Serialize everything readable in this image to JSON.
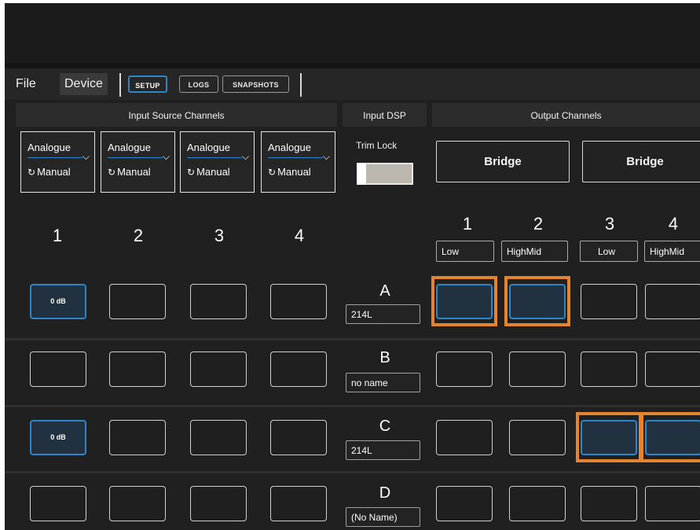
{
  "menu": {
    "file": "File",
    "device": "Device",
    "tabs": [
      {
        "label": "SETUP",
        "active": true
      },
      {
        "label": "LOGS",
        "active": false
      },
      {
        "label": "SNAPSHOTS",
        "active": false
      }
    ]
  },
  "sections": {
    "input_source": "Input Source Channels",
    "input_dsp": "Input DSP",
    "output_channels": "Output Channels"
  },
  "input_sources": [
    {
      "type": "Analogue",
      "mode": "Manual",
      "mode_icon": "refresh-icon"
    },
    {
      "type": "Analogue",
      "mode": "Manual",
      "mode_icon": "refresh-icon"
    },
    {
      "type": "Analogue",
      "mode": "Manual",
      "mode_icon": "refresh-icon"
    },
    {
      "type": "Analogue",
      "mode": "Manual",
      "mode_icon": "refresh-icon"
    }
  ],
  "trim_lock": {
    "label": "Trim Lock",
    "enabled": false
  },
  "bridge": [
    "Bridge",
    "Bridge"
  ],
  "input_numbers": [
    "1",
    "2",
    "3",
    "4"
  ],
  "output_channels": [
    {
      "number": "1",
      "eq": "Low"
    },
    {
      "number": "2",
      "eq": "HighMid"
    },
    {
      "number": "3",
      "eq": "Low"
    },
    {
      "number": "4",
      "eq": "HighMid"
    }
  ],
  "rows": [
    {
      "letter": "A",
      "name": "214L",
      "inputs": [
        "0 dB",
        "",
        "",
        ""
      ],
      "input_active": [
        true,
        false,
        false,
        false
      ],
      "outputs_active": [
        true,
        true,
        false,
        false
      ],
      "outputs_selected": [
        true,
        true,
        false,
        false
      ]
    },
    {
      "letter": "B",
      "name": "no name",
      "inputs": [
        "",
        "",
        "",
        ""
      ],
      "input_active": [
        false,
        false,
        false,
        false
      ],
      "outputs_active": [
        false,
        false,
        false,
        false
      ],
      "outputs_selected": [
        false,
        false,
        false,
        false
      ]
    },
    {
      "letter": "C",
      "name": "214L",
      "inputs": [
        "0 dB",
        "",
        "",
        ""
      ],
      "input_active": [
        true,
        false,
        false,
        false
      ],
      "outputs_active": [
        false,
        false,
        true,
        true
      ],
      "outputs_selected": [
        false,
        false,
        true,
        true
      ]
    },
    {
      "letter": "D",
      "name": "(No Name)",
      "inputs": [
        "",
        "",
        "",
        ""
      ],
      "input_active": [
        false,
        false,
        false,
        false
      ],
      "outputs_active": [
        false,
        false,
        false,
        false
      ],
      "outputs_selected": [
        false,
        false,
        false,
        false
      ]
    }
  ],
  "colors": {
    "accent": "#2d86c8",
    "selection": "#e5842f",
    "background": "#202020"
  }
}
